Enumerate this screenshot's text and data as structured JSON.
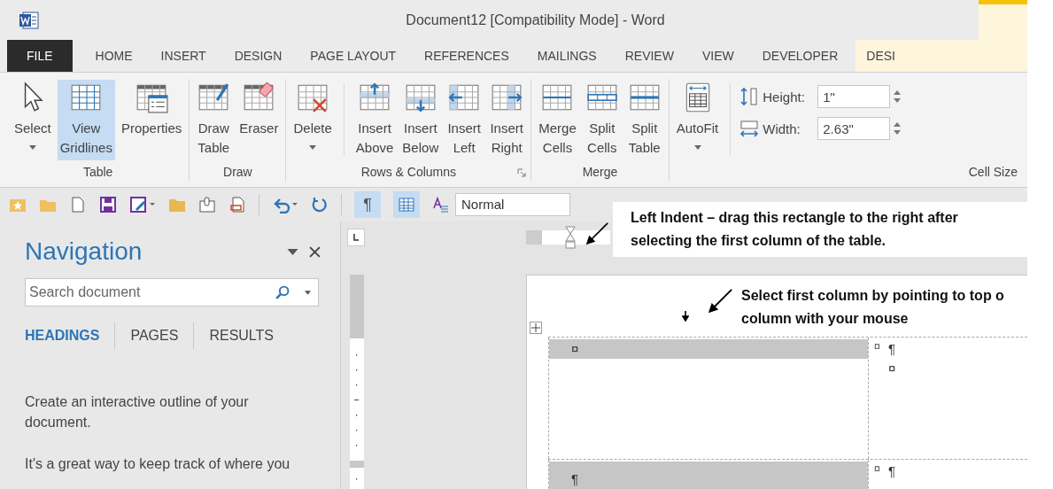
{
  "window": {
    "title": "Document12 [Compatibility Mode] - Word"
  },
  "ribbon_tabs": [
    {
      "label": "FILE",
      "kind": "file"
    },
    {
      "label": "HOME",
      "kind": "normal"
    },
    {
      "label": "INSERT",
      "kind": "normal"
    },
    {
      "label": "DESIGN",
      "kind": "normal"
    },
    {
      "label": "PAGE LAYOUT",
      "kind": "normal"
    },
    {
      "label": "REFERENCES",
      "kind": "normal"
    },
    {
      "label": "MAILINGS",
      "kind": "normal"
    },
    {
      "label": "REVIEW",
      "kind": "normal"
    },
    {
      "label": "VIEW",
      "kind": "normal"
    },
    {
      "label": "DEVELOPER",
      "kind": "normal"
    },
    {
      "label": "DESI",
      "kind": "contextual"
    }
  ],
  "ribbon_groups": [
    {
      "label": "Table",
      "buttons": [
        {
          "label": "Select",
          "dropdown": true,
          "selected": false
        },
        {
          "label": "View\nGridlines",
          "dropdown": false,
          "selected": true
        },
        {
          "label": "Properties",
          "dropdown": false,
          "selected": false
        }
      ]
    },
    {
      "label": "Draw",
      "buttons": [
        {
          "label": "Draw\nTable",
          "dropdown": false,
          "selected": false
        },
        {
          "label": "Eraser",
          "dropdown": false,
          "selected": false
        }
      ]
    },
    {
      "label": "Rows & Columns",
      "launcher": true,
      "buttons": [
        {
          "label": "Delete",
          "dropdown": true,
          "selected": false
        },
        {
          "label": "Insert\nAbove",
          "dropdown": false,
          "selected": false
        },
        {
          "label": "Insert\nBelow",
          "dropdown": false,
          "selected": false
        },
        {
          "label": "Insert\nLeft",
          "dropdown": false,
          "selected": false
        },
        {
          "label": "Insert\nRight",
          "dropdown": false,
          "selected": false
        }
      ]
    },
    {
      "label": "Merge",
      "buttons": [
        {
          "label": "Merge\nCells",
          "dropdown": false,
          "selected": false
        },
        {
          "label": "Split\nCells",
          "dropdown": false,
          "selected": false
        },
        {
          "label": "Split\nTable",
          "dropdown": false,
          "selected": false
        }
      ]
    },
    {
      "label": "Cell Size",
      "buttons": [
        {
          "label": "AutoFit",
          "dropdown": true,
          "selected": false
        }
      ],
      "fields": [
        {
          "label": "Height:",
          "value": "1\""
        },
        {
          "label": "Width:",
          "value": "2.63\""
        }
      ]
    }
  ],
  "quick_access": {
    "toggles": [
      {
        "kind": "mark",
        "label": "¶",
        "on": true
      },
      {
        "kind": "grid",
        "on": true
      }
    ],
    "style_box": {
      "value": "Normal"
    }
  },
  "navigation": {
    "title": "Navigation",
    "search": {
      "placeholder": "Search document"
    },
    "tabs": [
      {
        "label": "HEADINGS",
        "selected": true
      },
      {
        "label": "PAGES",
        "selected": false
      },
      {
        "label": "RESULTS",
        "selected": false
      }
    ],
    "paragraphs": [
      "Create an interactive outline of your document.",
      "It's a great way to keep track of where you"
    ]
  },
  "document": {
    "callouts": [
      "Left Indent – drag this rectangle to the right after\nselecting the first column of the table.",
      "Select first column by pointing to top o\ncolumn with your mouse"
    ],
    "table": {
      "rows": [
        {
          "end_mark": "¤",
          "cells": [
            {
              "lines": [
                {
                  "text": "¤",
                  "selected": true
                }
              ]
            },
            {
              "lines": [
                {
                  "text": "¶",
                  "selected": false
                },
                {
                  "text": "¤",
                  "selected": false
                }
              ]
            }
          ]
        },
        {
          "end_mark": "¤",
          "cells": [
            {
              "lines": [
                {
                  "text": "¶",
                  "selected": true
                }
              ]
            },
            {
              "lines": [
                {
                  "text": "¶",
                  "selected": false
                }
              ]
            }
          ]
        }
      ]
    }
  }
}
